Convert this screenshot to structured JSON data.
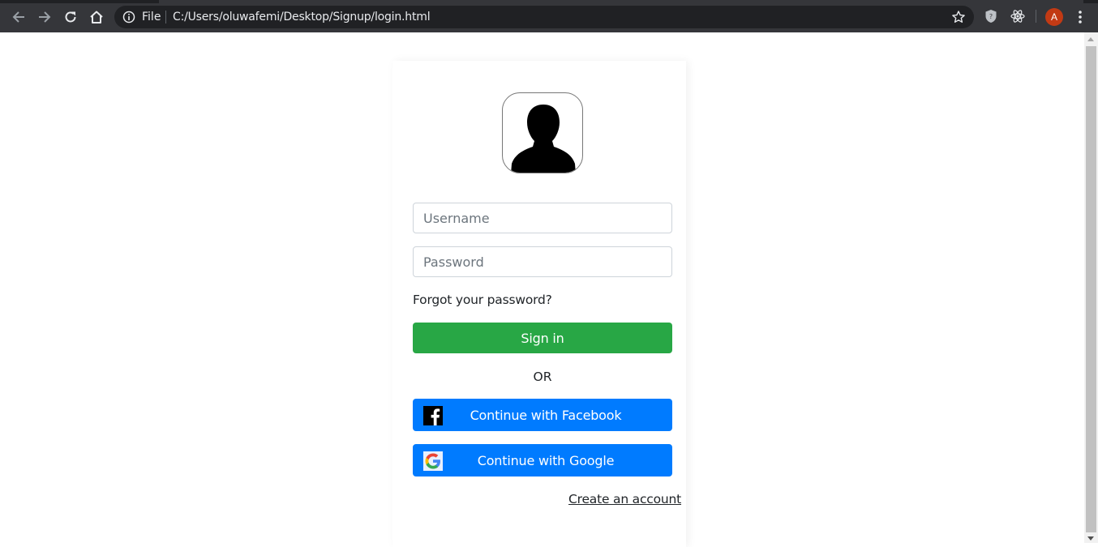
{
  "browser": {
    "scheme_label": "File",
    "url": "C:/Users/oluwafemi/Desktop/Signup/login.html",
    "avatar_initial": "A"
  },
  "login": {
    "username_placeholder": "Username",
    "password_placeholder": "Password",
    "forgot_password": "Forgot your password?",
    "sign_in": "Sign in",
    "or": "OR",
    "facebook": "Continue with Facebook",
    "google": "Continue with Google",
    "create_account": "Create an account"
  },
  "colors": {
    "sign_in": "#28a745",
    "social": "#007bff",
    "avatar": "#c23a14"
  },
  "icons": [
    "back-arrow-icon",
    "forward-arrow-icon",
    "reload-icon",
    "home-icon",
    "info-icon",
    "star-icon",
    "shield-icon",
    "react-icon",
    "more-vert-icon",
    "user-silhouette-icon",
    "facebook-icon",
    "google-icon"
  ]
}
